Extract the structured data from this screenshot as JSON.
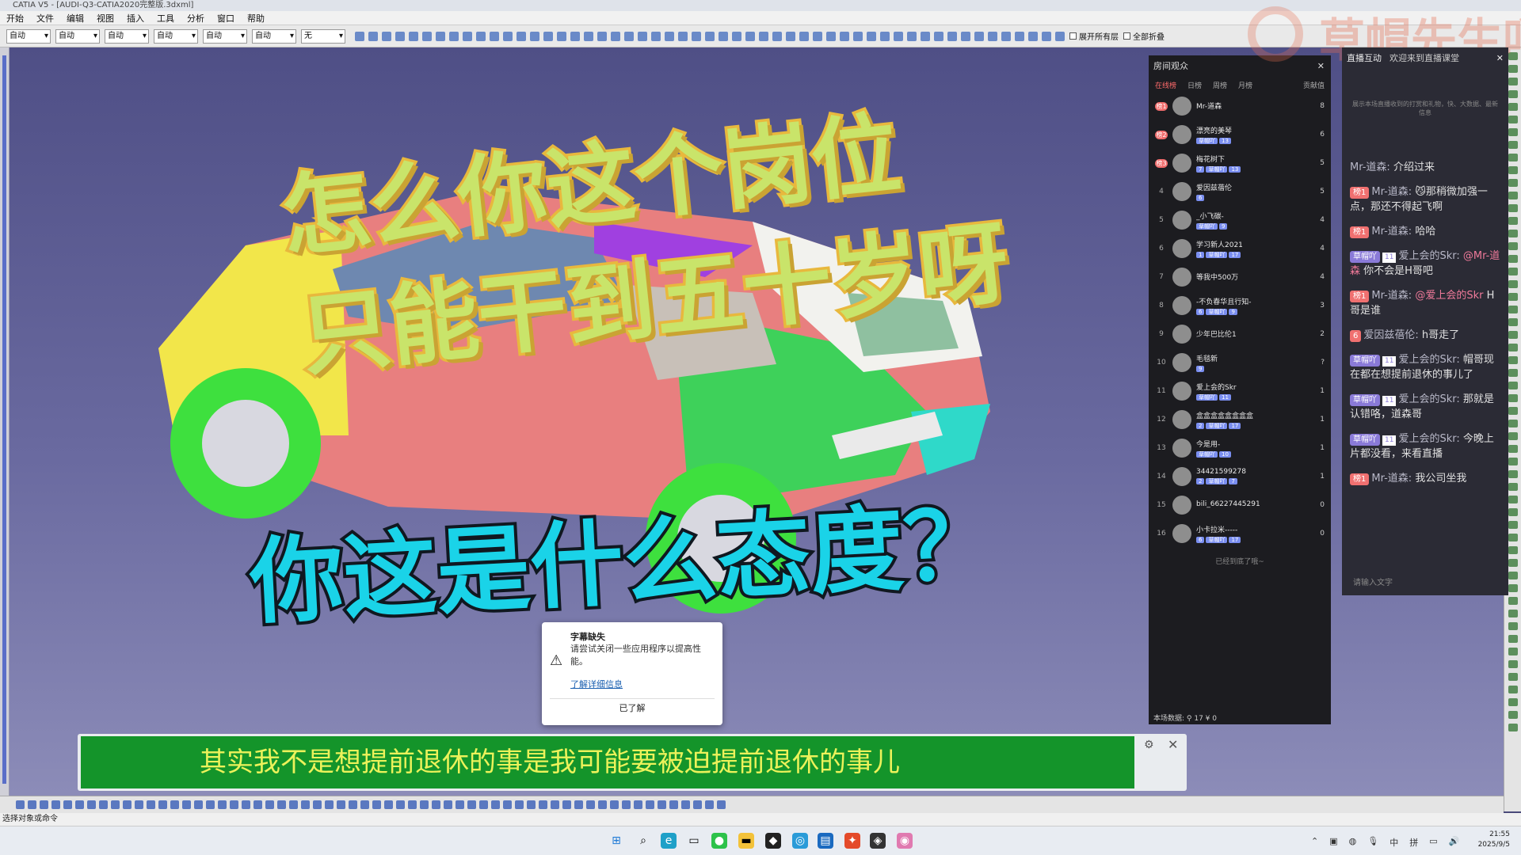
{
  "window": {
    "title": "CATIA V5 - [AUDI-Q3-CATIA2020完整版.3dxml]"
  },
  "menu": [
    "开始",
    "文件",
    "编辑",
    "视图",
    "插入",
    "工具",
    "分析",
    "窗口",
    "帮助"
  ],
  "toolbar": {
    "combos": [
      "自动",
      "自动",
      "自动",
      "自动",
      "自动",
      "自动",
      "无"
    ],
    "checks": [
      "展开所有层",
      "全部折叠"
    ]
  },
  "overlay": {
    "line1": "怎么你这个岗位",
    "line2": "只能干到五十岁呀",
    "line3": "你这是什么态度？"
  },
  "viewers_panel": {
    "title": "房间观众",
    "tabs": [
      "在线榜",
      "日榜",
      "周榜",
      "月榜"
    ],
    "tab_right": "贡献值",
    "rows": [
      {
        "rank": "榜1",
        "name": "Mr-道森",
        "tags": [],
        "score": "8"
      },
      {
        "rank": "榜2",
        "name": "漂亮的美琴",
        "tags": [
          "草帽吖",
          "13"
        ],
        "score": "6"
      },
      {
        "rank": "榜3",
        "name": "梅花树下",
        "tags": [
          "7",
          "草帽吖",
          "13"
        ],
        "score": "5"
      },
      {
        "rank": "4",
        "name": "爱因兹蓓伦",
        "tags": [
          "6"
        ],
        "score": "5"
      },
      {
        "rank": "5",
        "name": "_小飞碳-",
        "tags": [
          "草帽吖",
          "9"
        ],
        "score": "4"
      },
      {
        "rank": "6",
        "name": "学习新人2021",
        "tags": [
          "1",
          "草帽吖",
          "17"
        ],
        "score": "4"
      },
      {
        "rank": "7",
        "name": "等我中500万",
        "tags": [],
        "score": "4"
      },
      {
        "rank": "8",
        "name": "-不负春华且行知-",
        "tags": [
          "6",
          "草帽吖",
          "9"
        ],
        "score": "3"
      },
      {
        "rank": "9",
        "name": "少年巴比伦1",
        "tags": [],
        "score": "2"
      },
      {
        "rank": "10",
        "name": "毛毯新",
        "tags": [
          "9"
        ],
        "score": "?"
      },
      {
        "rank": "11",
        "name": "爱上会的Skr",
        "tags": [
          "草帽吖",
          "11"
        ],
        "score": "1"
      },
      {
        "rank": "12",
        "name": "盒盒盒盒盒盒盒盒",
        "tags": [
          "2",
          "草帽吖",
          "17"
        ],
        "score": "1"
      },
      {
        "rank": "13",
        "name": "今是用-",
        "tags": [
          "草帽吖",
          "10"
        ],
        "score": "1"
      },
      {
        "rank": "14",
        "name": "34421599278",
        "tags": [
          "2",
          "草帽吖",
          "7"
        ],
        "score": "1"
      },
      {
        "rank": "15",
        "name": "bili_66227445291",
        "tags": [],
        "score": "0"
      },
      {
        "rank": "16",
        "name": "小卡拉米-----",
        "tags": [
          "6",
          "草帽吖",
          "17"
        ],
        "score": "0"
      }
    ],
    "end_text": "已经到底了哦~",
    "footer": "本场数据:  ⚲ 17  ¥ 0"
  },
  "chat": {
    "title": "直播互动",
    "header_overlay": "欢迎来到直播课堂",
    "notice": "展示本场直播收到的打赏和礼物，快、大数据、最新信息",
    "messages": [
      {
        "badge": "",
        "level": "",
        "user": "Mr-道森:",
        "text": "介绍过来"
      },
      {
        "badge": "榜1",
        "level": "",
        "user": "Mr-道森:",
        "text": "😼那稍微加强一点，那还不得起飞啊"
      },
      {
        "badge": "榜1",
        "level": "",
        "user": "Mr-道森:",
        "text": "哈哈"
      },
      {
        "badge": "草帽吖",
        "level": "11",
        "user": "爱上会的Skr:",
        "at": "@Mr-道森",
        "text": "你不会是H哥吧"
      },
      {
        "badge": "榜1",
        "level": "",
        "user": "Mr-道森:",
        "at": "@爱上会的Skr",
        "text": "H哥是谁"
      },
      {
        "badge": "6",
        "level": "",
        "user": "爱因兹蓓伦:",
        "text": "h哥走了"
      },
      {
        "badge": "草帽吖",
        "level": "11",
        "user": "爱上会的Skr:",
        "text": "帽哥现在都在想提前退休的事儿了"
      },
      {
        "badge": "草帽吖",
        "level": "11",
        "user": "爱上会的Skr:",
        "text": "那就是认错咯，道森哥"
      },
      {
        "badge": "草帽吖",
        "level": "11",
        "user": "爱上会的Skr:",
        "text": "今晚上片都没看，来看直播"
      },
      {
        "badge": "榜1",
        "level": "",
        "user": "Mr-道森:",
        "text": "我公司坐我"
      }
    ],
    "input_placeholder": "请输入文字"
  },
  "watermark": "草帽先生吖",
  "toast": {
    "title": "字幕缺失",
    "body": "请尝试关闭一些应用程序以提高性能。",
    "link": "了解详细信息",
    "button": "已了解"
  },
  "subtitle": "其实我不是想提前退休的事是我可能要被迫提前退休的事儿",
  "status": "选择对象或命令",
  "clock": {
    "time": "21:55",
    "date": "2025/9/5"
  },
  "ime": [
    "中",
    "拼"
  ],
  "colors": {
    "subtitle_bg": "#14942a",
    "subtitle_text": "#ecf25a",
    "overlay_yellow": "#c9e46a",
    "overlay_cyan": "#1ad3e8"
  }
}
